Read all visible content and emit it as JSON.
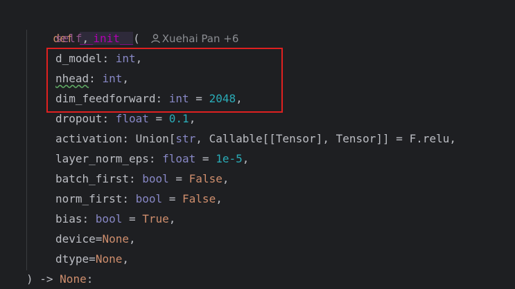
{
  "code": {
    "def_keyword": "def",
    "func_name": "__init__",
    "open_paren": "(",
    "author_inlay": "Xuehai Pan +6",
    "params": [
      {
        "name": "self",
        "sep": ","
      },
      {
        "name": "d_model",
        "colon": ": ",
        "type": "int",
        "sep": ","
      },
      {
        "name": "nhead",
        "colon": ": ",
        "type": "int",
        "sep": ","
      },
      {
        "name": "dim_feedforward",
        "colon": ": ",
        "type": "int",
        "eq": " = ",
        "default": "2048",
        "sep": ","
      },
      {
        "name": "dropout",
        "colon": ": ",
        "type": "float",
        "eq": " = ",
        "default": "0.1",
        "sep": ","
      },
      {
        "name": "activation",
        "colon": ": ",
        "type_text": "Union[",
        "str": "str",
        "type_rest": ", Callable[[Tensor], Tensor]]",
        "eq": " = ",
        "default": "F.relu",
        "sep": ","
      },
      {
        "name": "layer_norm_eps",
        "colon": ": ",
        "type": "float",
        "eq": " = ",
        "default": "1e-5",
        "sep": ","
      },
      {
        "name": "batch_first",
        "colon": ": ",
        "type": "bool",
        "eq": " = ",
        "default": "False",
        "sep": ","
      },
      {
        "name": "norm_first",
        "colon": ": ",
        "type": "bool",
        "eq": " = ",
        "default": "False",
        "sep": ","
      },
      {
        "name": "bias",
        "colon": ": ",
        "type": "bool",
        "eq": " = ",
        "default": "True",
        "sep": ","
      },
      {
        "name": "device",
        "eq": "=",
        "default": "None",
        "sep": ","
      },
      {
        "name": "dtype",
        "eq": "=",
        "default": "None",
        "sep": ","
      }
    ],
    "close": ") -> ",
    "return_type": "None",
    "end_colon": ":"
  },
  "colors": {
    "background": "#1e1f22",
    "keyword": "#cf8e6d",
    "number": "#2aacb8",
    "type": "#8888c6",
    "highlight": "#e02020"
  },
  "icons": {
    "author": "person-icon"
  }
}
